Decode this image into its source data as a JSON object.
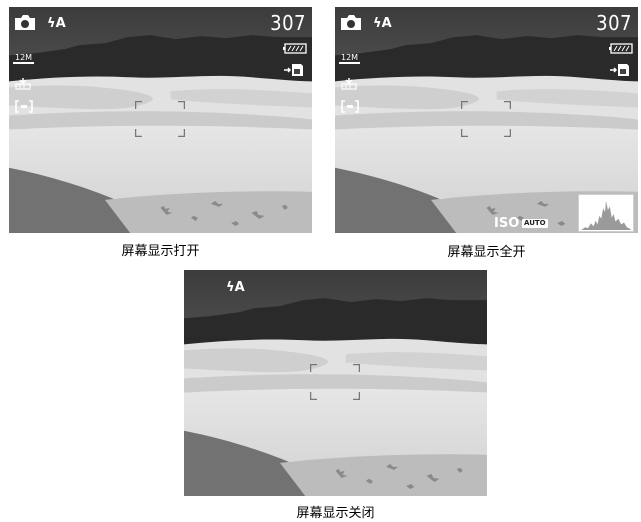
{
  "panels": [
    {
      "id": "display-on",
      "caption": "屏幕显示打开",
      "hud": {
        "flash_mode": "A",
        "shots_remaining": "307",
        "resolution": "12M",
        "battery": "full",
        "storage": "internal",
        "focus_area": "center"
      }
    },
    {
      "id": "display-full",
      "caption": "屏幕显示全开",
      "hud": {
        "flash_mode": "A",
        "shots_remaining": "307",
        "resolution": "12M",
        "battery": "full",
        "storage": "internal",
        "focus_area": "center",
        "iso_label": "ISO",
        "iso_value": "AUTO"
      }
    },
    {
      "id": "display-off",
      "caption": "屏幕显示关闭",
      "hud": {
        "flash_mode": "A"
      }
    }
  ],
  "icons": [
    "camera-icon",
    "flash-icon",
    "resolution-12m-icon",
    "battery-icon",
    "internal-memory-icon",
    "metering-icon",
    "focus-area-icon",
    "histogram-icon",
    "focus-frame-icon"
  ]
}
